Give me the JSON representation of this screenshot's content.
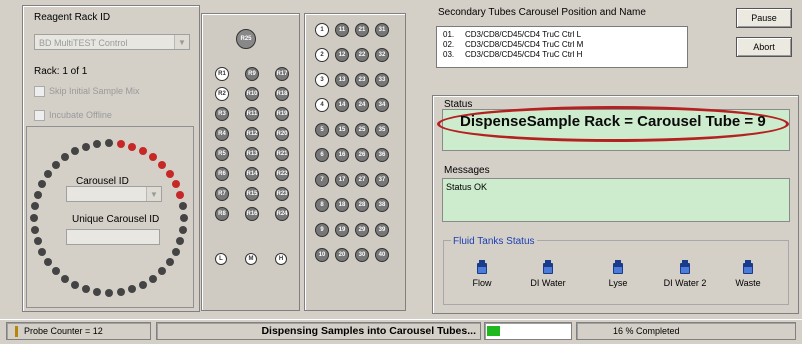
{
  "reagent": {
    "label": "Reagent Rack ID",
    "value": "BD MultiTEST Control",
    "rack_label": "Rack:  1 of 1",
    "skip_label": "Skip Initial Sample Mix",
    "incubate_label": "Incubate Offline"
  },
  "carousel": {
    "id_label": "Carousel ID",
    "unique_label": "Unique Carousel ID"
  },
  "rack_left": {
    "big": "R25",
    "col1": [
      "R1",
      "R2",
      "R3",
      "R4",
      "R5",
      "R6",
      "R7",
      "R8"
    ],
    "col2": [
      "R9",
      "R10",
      "R11",
      "R12",
      "R13",
      "R14",
      "R15",
      "R16"
    ],
    "col3": [
      "R17",
      "R18",
      "R19",
      "R20",
      "R21",
      "R22",
      "R23",
      "R24"
    ],
    "bottom": [
      "L",
      "M",
      "H"
    ]
  },
  "rack_right": {
    "rows": [
      [
        "1",
        "11",
        "21",
        "31"
      ],
      [
        "2",
        "12",
        "22",
        "32"
      ],
      [
        "3",
        "13",
        "23",
        "33"
      ],
      [
        "4",
        "14",
        "24",
        "34"
      ],
      [
        "5",
        "15",
        "25",
        "35"
      ],
      [
        "6",
        "16",
        "26",
        "36"
      ],
      [
        "7",
        "17",
        "27",
        "37"
      ],
      [
        "8",
        "18",
        "28",
        "38"
      ],
      [
        "9",
        "19",
        "29",
        "39"
      ],
      [
        "10",
        "20",
        "30",
        "40"
      ]
    ]
  },
  "tubes": {
    "header": "Secondary Tubes Carousel Position and  Name",
    "items": [
      {
        "num": "01.",
        "name": "CD3/CD8/CD45/CD4 TruC Ctrl L"
      },
      {
        "num": "02.",
        "name": "CD3/CD8/CD45/CD4 TruC Ctrl M"
      },
      {
        "num": "03.",
        "name": "CD3/CD8/CD45/CD4 TruC Ctrl H"
      }
    ]
  },
  "buttons": {
    "pause": "Pause",
    "abort": "Abort"
  },
  "status": {
    "label": "Status",
    "text": "DispenseSample Rack = Carousel Tube = 9"
  },
  "messages": {
    "label": "Messages",
    "text": "Status OK"
  },
  "tanks": {
    "label": "Fluid Tanks Status",
    "items": [
      "Flow",
      "DI Water",
      "Lyse",
      "DI Water 2",
      "Waste"
    ]
  },
  "statusbar": {
    "probe": "Probe Counter = 12",
    "message": "Dispensing Samples into Carousel Tubes...",
    "percent": "16 % Completed",
    "progress": 0.16
  },
  "colors": {
    "highlight_ring": "#c62828",
    "status_bg": "#cdeccd",
    "progress": "#1fb81f"
  }
}
